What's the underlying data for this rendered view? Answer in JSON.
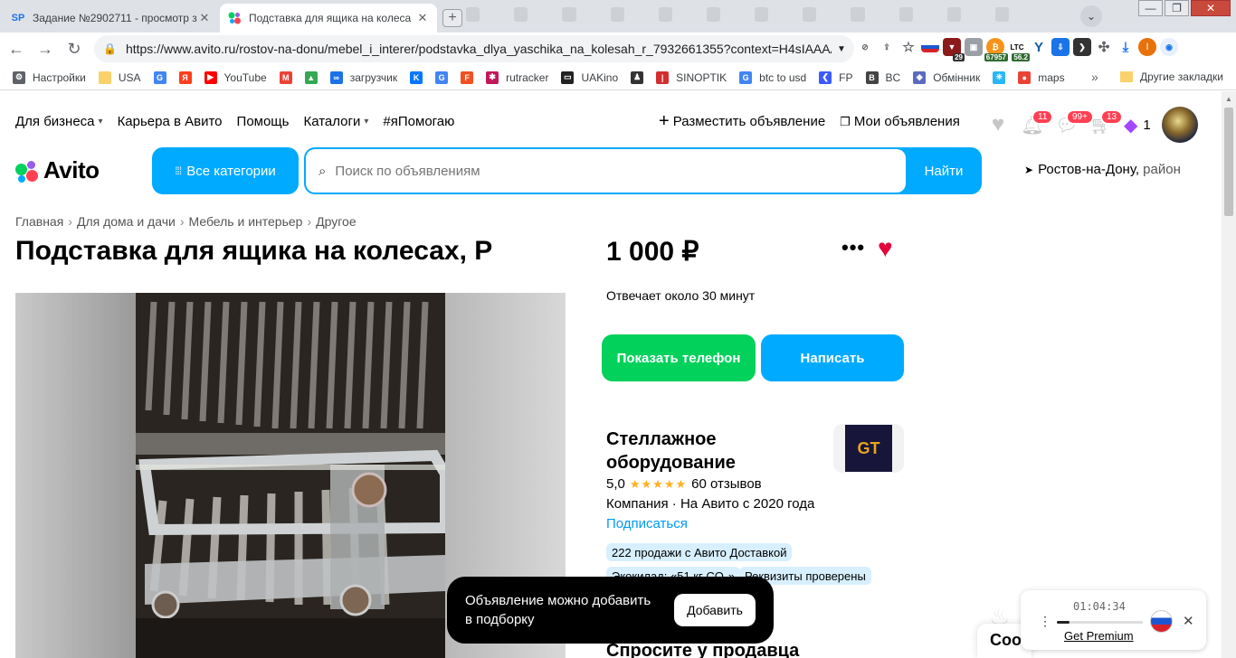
{
  "browser": {
    "tabs": [
      {
        "favicon": "SP",
        "title": "Задание №2902711 - просмотр з",
        "active": false
      },
      {
        "favicon": "avito-dots",
        "title": "Подставка для ящика на колеса",
        "active": true
      }
    ],
    "url": "https://www.avito.ru/rostov-na-donu/mebel_i_interer/podstavka_dlya_yaschika_na_kolesah_r_7932661355?context=H4sIAAAA...",
    "extensions": [
      {
        "icon": "russia-flag-icon",
        "badge": ""
      },
      {
        "icon": "shield-icon",
        "badge": "29"
      },
      {
        "icon": "gift-icon",
        "badge": ""
      },
      {
        "icon": "bitcoin-icon",
        "badge": "67957"
      },
      {
        "icon": "ltc-icon",
        "label": "LTC",
        "badge": "56.2"
      },
      {
        "icon": "v-icon",
        "badge": ""
      },
      {
        "icon": "download-icon",
        "badge": ""
      },
      {
        "icon": "arrow-icon",
        "badge": ""
      },
      {
        "icon": "puzzle-icon",
        "badge": ""
      },
      {
        "icon": "downloads-icon",
        "badge": ""
      }
    ],
    "profile_letter": "I",
    "bookmarks": [
      {
        "icon": "gear-icon",
        "label": "Настройки"
      },
      {
        "icon": "folder-icon",
        "label": "USA"
      },
      {
        "icon": "google-icon",
        "label": ""
      },
      {
        "icon": "yandex-icon",
        "label": ""
      },
      {
        "icon": "youtube-icon",
        "label": "YouTube"
      },
      {
        "icon": "gmail-icon",
        "label": ""
      },
      {
        "icon": "drive-icon",
        "label": ""
      },
      {
        "icon": "infinity-icon",
        "label": "загрузчик"
      },
      {
        "icon": "vk-icon",
        "label": ""
      },
      {
        "icon": "translate-icon",
        "label": ""
      },
      {
        "icon": "f-icon",
        "label": ""
      },
      {
        "icon": "rutracker-icon",
        "label": "rutracker"
      },
      {
        "icon": "uakino-icon",
        "label": "UAKino"
      },
      {
        "icon": "person-icon",
        "label": ""
      },
      {
        "icon": "thermometer-icon",
        "label": "SINOPTIK"
      },
      {
        "icon": "google-icon",
        "label": "btc to usd"
      },
      {
        "icon": "fp-icon",
        "label": "FP"
      },
      {
        "icon": "bc-icon",
        "label": "BC"
      },
      {
        "icon": "exchange-icon",
        "label": "Обмінник"
      },
      {
        "icon": "star-icon",
        "label": ""
      },
      {
        "icon": "maps-icon",
        "label": "maps"
      }
    ],
    "more_bookmarks": "»",
    "other_bookmarks": "Другие закладки"
  },
  "avito": {
    "topnav": [
      {
        "label": "Для бизнеса",
        "dropdown": true
      },
      {
        "label": "Карьера в Авито",
        "dropdown": false
      },
      {
        "label": "Помощь",
        "dropdown": false
      },
      {
        "label": "Каталоги",
        "dropdown": true
      },
      {
        "label": "#яПомогаю",
        "dropdown": false
      }
    ],
    "post_ad": "Разместить объявление",
    "my_ads": "Мои объявления",
    "counters": {
      "notifications": "11",
      "messages": "99+",
      "cart": "13",
      "tickets": "1"
    },
    "logo_text": "Avito",
    "all_categories": "Все категории",
    "search_placeholder": "Поиск по объявлениям",
    "search_button": "Найти",
    "location": "Ростов-на-Дону,",
    "location_suffix": " район",
    "breadcrumb": [
      "Главная",
      "Для дома и дачи",
      "Мебель и интерьер",
      "Другое"
    ],
    "title": "Подставка для ящика на колесах, Р",
    "price": "1 000 ₽",
    "response_time": "Отвечает около 30 минут",
    "show_phone": "Показать телефон",
    "write": "Написать",
    "seller": {
      "name": "Стеллажное оборудование",
      "logo_text": "GT",
      "rating": "5,0",
      "stars": "★★★★★",
      "reviews": "60 отзывов",
      "info": "Компания · На Авито с 2020 года",
      "subscribe": "Подписаться",
      "chips": [
        "222 продажи с Авито Доставкой",
        "Экокилад: «51 кг CO₂»",
        "Реквизиты проверены"
      ]
    },
    "ask_seller": "Спросите у продавца",
    "toast": {
      "message": "Объявление можно добавить в подборку",
      "button": "Добавить"
    },
    "chat_peek": "Соо"
  },
  "player": {
    "time": "01:04:34",
    "premium": "Get Premium",
    "progress": 0.15
  }
}
